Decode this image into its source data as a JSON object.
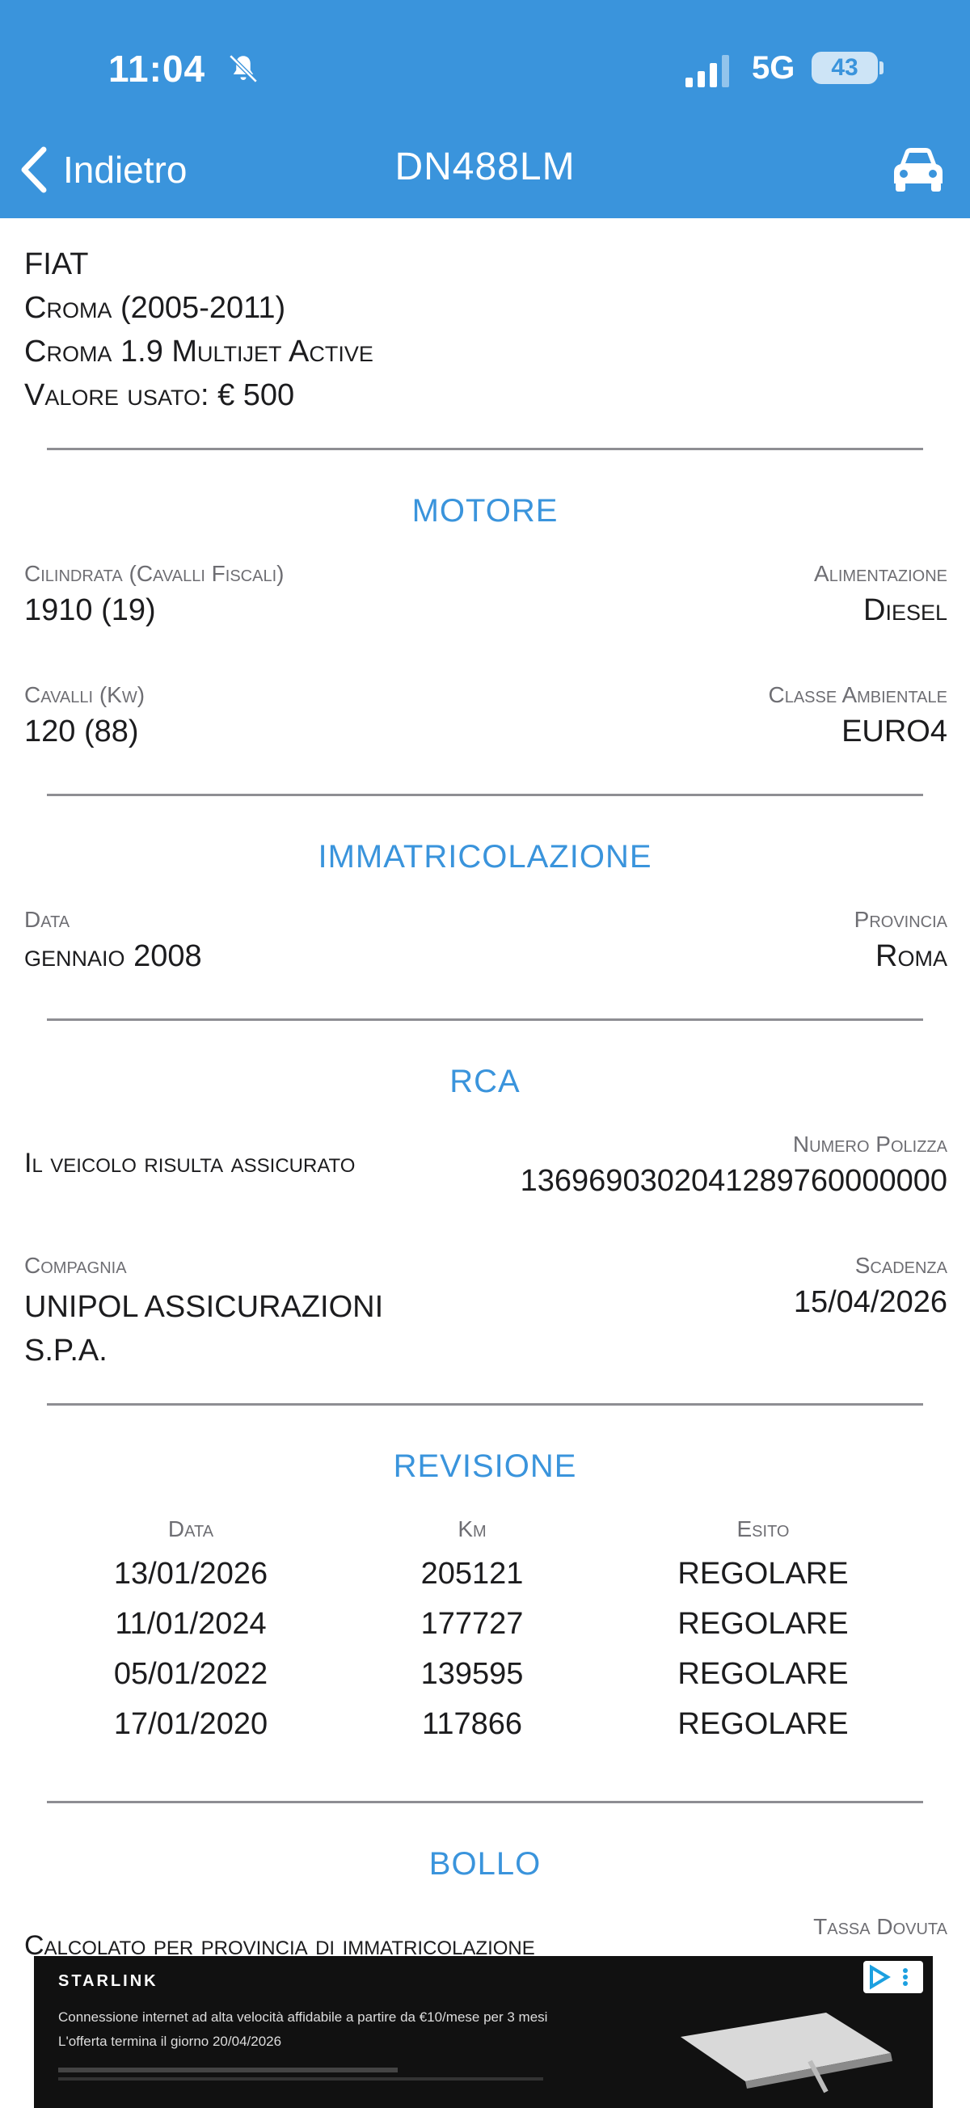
{
  "status_bar": {
    "time": "11:04",
    "network": "5G",
    "battery": "43"
  },
  "nav": {
    "back_label": "Indietro",
    "title": "DN488LM"
  },
  "vehicle": {
    "brand": "FIAT",
    "model": "Croma (2005-2011)",
    "version": "Croma 1.9 Multijet Active",
    "used_value": "Valore usato: € 500"
  },
  "motore": {
    "title": "MOTORE",
    "cilindrata_label": "Cilindrata (Cavalli Fiscali)",
    "cilindrata_value": "1910 (19)",
    "alimentazione_label": "Alimentazione",
    "alimentazione_value": "Diesel",
    "cavalli_label": "Cavalli (Kw)",
    "cavalli_value": "120 (88)",
    "classe_label": "Classe Ambientale",
    "classe_value": "EURO4"
  },
  "immatricolazione": {
    "title": "IMMATRICOLAZIONE",
    "data_label": "Data",
    "data_value": "gennaio 2008",
    "provincia_label": "Provincia",
    "provincia_value": "Roma"
  },
  "rca": {
    "title": "RCA",
    "status": "Il veicolo risulta assicurato",
    "polizza_label": "Numero Polizza",
    "polizza_value": "1369690302041289760000000",
    "compagnia_label": "Compagnia",
    "compagnia_line1": "UNIPOL ASSICURAZIONI",
    "compagnia_line2": "S.P.A.",
    "scadenza_label": "Scadenza",
    "scadenza_value": "15/04/2026"
  },
  "revisione": {
    "title": "REVISIONE",
    "headers": [
      "Data",
      "Km",
      "Esito"
    ],
    "rows": [
      [
        "13/01/2026",
        "205121",
        "REGOLARE"
      ],
      [
        "11/01/2024",
        "177727",
        "REGOLARE"
      ],
      [
        "05/01/2022",
        "139595",
        "REGOLARE"
      ],
      [
        "17/01/2020",
        "117866",
        "REGOLARE"
      ]
    ]
  },
  "bollo": {
    "title": "BOLLO",
    "calc_text": "Calcolato per provincia di immatricolazione",
    "tassa_label": "Tassa Dovuta"
  },
  "ad": {
    "brand": "STARLINK",
    "line1": "Connessione internet ad alta velocità affidabile a partire da €10/mese per 3 mesi",
    "line2": "L'offerta termina il giorno 20/04/2026"
  },
  "colors": {
    "accent": "#3a94dc",
    "label_grey": "#6e6e73",
    "divider": "#8e8e93"
  }
}
